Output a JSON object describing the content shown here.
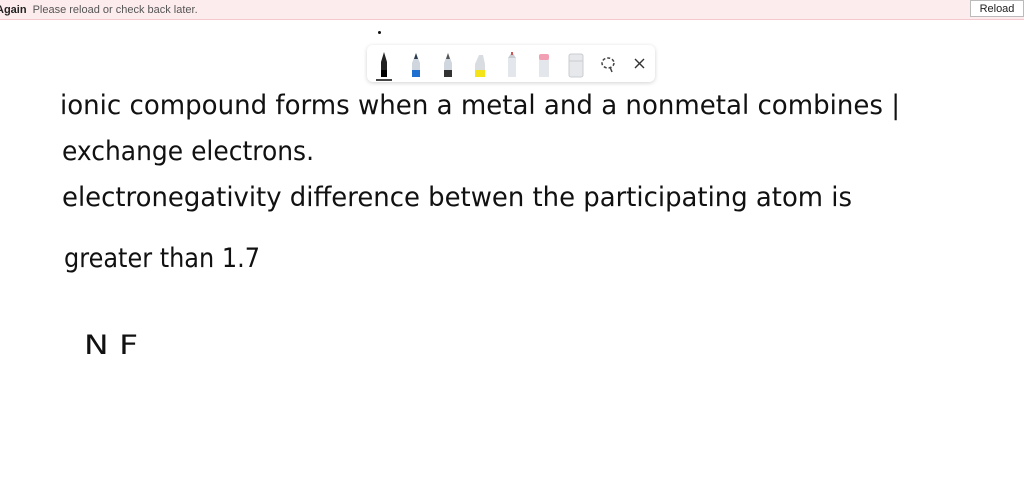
{
  "notification": {
    "title": "Again",
    "message": "Please reload or check back later.",
    "reload_label": "Reload"
  },
  "toolbar": {
    "tools": [
      "pen-black",
      "pen-blue",
      "pen-gray",
      "highlighter-yellow",
      "pencil",
      "highlighter-pink",
      "eraser",
      "lasso-select",
      "close"
    ],
    "active_tool": "pen-black"
  },
  "ink": {
    "line1": "ionic compound forms when a metal and a nonmetal combines |",
    "line2": "exchange electrons.",
    "line3": "electronegativity difference betwen the participating atom is",
    "line4": "greater than 1.7",
    "line5": "N F"
  },
  "colors": {
    "notification_bg": "#fdecee",
    "ink": "#111111",
    "pen_blue": "#1f6fd1",
    "highlighter_yellow": "#f5e31a",
    "highlighter_pink": "#f29fb3"
  }
}
